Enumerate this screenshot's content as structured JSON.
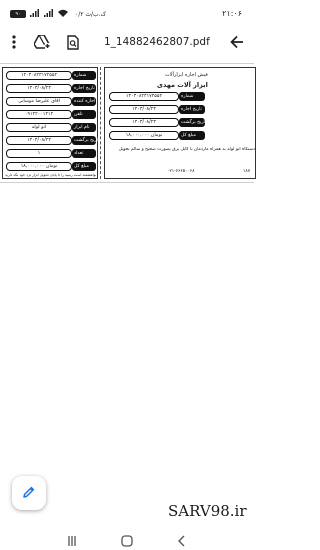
{
  "status_bar": {
    "time": "۲۱:۰۶",
    "battery": "۹۰",
    "network_speed": "۰/۲ ک.ب/ث"
  },
  "toolbar": {
    "file_name": "1_14882462807.pdf",
    "icons": [
      "more-vert-icon",
      "drive-add-icon",
      "doc-search-icon",
      "back-arrow-icon"
    ]
  },
  "document": {
    "left_slip": {
      "rows": [
        {
          "label": "شماره",
          "value": "۱۴۰۳۰۸۲۳۱۷۲۵۵۲"
        },
        {
          "label": "تاریخ اجاره",
          "value": "۱۴۰۳/۰۸/۲۳"
        },
        {
          "label": "اجاره کننده",
          "value": "آقای علیرضا موسایی"
        },
        {
          "label": "تلفن",
          "value": "۰۹۱۲۲۰۰۱۲۱۲"
        },
        {
          "label": "نام ابزار",
          "value": "انو لوله"
        },
        {
          "label": "تاریخ برگشت",
          "value": "۱۴۰۳/۰۸/۲۳"
        },
        {
          "label": "تعداد",
          "value": "۱"
        },
        {
          "label": "مبلغ کل",
          "value": "۱۸,۰۰۰,۰۰۰ تومان"
        }
      ],
      "footer": "توجه: مشتری گرامی خواهشمند است رسید را تا پایان تحویل ابزار نزد خود نگه دارید"
    },
    "right_slip": {
      "header_small": "فیش اجاره ابزارآلات",
      "shop_name": "ابزار آلات مهدی",
      "rows": [
        {
          "label": "شماره",
          "value": "۱۴۰۳۰۸۲۳۱۷۲۵۵۲"
        },
        {
          "label": "تاریخ اجاره",
          "value": "۱۴۰۳/۰۸/۲۳"
        },
        {
          "label": "تاریخ برگشت",
          "value": "۱۴۰۳/۰۸/۲۳"
        },
        {
          "label": "مبلغ کل",
          "value": "۱۸,۰۰۰,۰۰۰ تومان"
        }
      ],
      "note": "دستگاه انو لوله به همراه ماردمان با کابل برق بصورت صحیح و سالم تحویل",
      "phone_left": "۰۲۱-۶۶۶۵۰۰۶۸",
      "phone_right": "۱۸۷"
    }
  },
  "watermark": "SARV98.ir",
  "fab_icon": "edit-pencil-icon",
  "nav": [
    "recents-icon",
    "home-icon",
    "back-icon"
  ]
}
